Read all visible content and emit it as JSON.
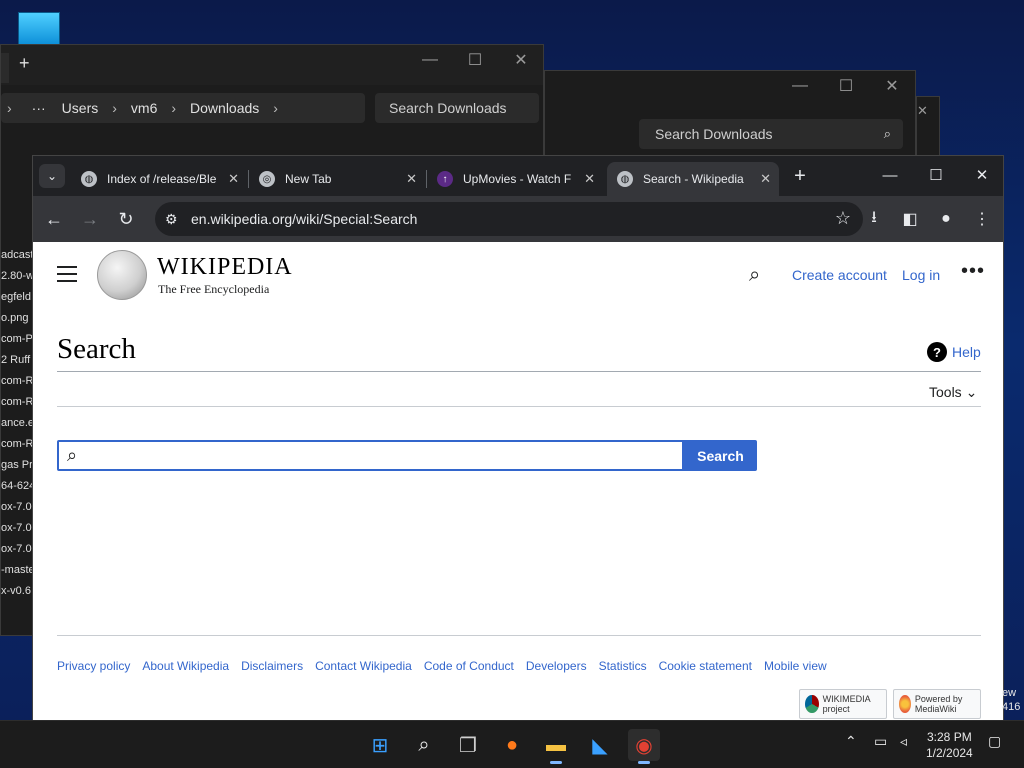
{
  "explorer_front": {
    "breadcrumbs": [
      "Users",
      "vm6",
      "Downloads"
    ],
    "search_placeholder": "Search Downloads",
    "new_tab": "+",
    "partial_files": [
      "adcast",
      "2.80-w",
      "egfeld",
      "o.png",
      "com-P",
      "2 Ruff",
      "com-R",
      "com-R",
      "ance.e",
      "com-R",
      "gas Pro",
      "64-624",
      "ox-7.0.",
      "ox-7.0.",
      "ox-7.0.",
      "-maste",
      "x-v0.6"
    ]
  },
  "explorer_back": {
    "search_placeholder": "Search Downloads"
  },
  "browser": {
    "tabs": [
      {
        "title": "Index of /release/Ble",
        "favicon": "globe-icon",
        "active": false
      },
      {
        "title": "New Tab",
        "favicon": "chrome-icon",
        "active": false
      },
      {
        "title": "UpMovies - Watch F",
        "favicon": "upmovies-icon",
        "active": false
      },
      {
        "title": "Search - Wikipedia",
        "favicon": "globe-icon",
        "active": true
      }
    ],
    "url": "en.wikipedia.org/wiki/Special:Search"
  },
  "wiki": {
    "wordmark": "WIKIPEDIA",
    "tagline": "The Free Encyclopedia",
    "create_account": "Create account",
    "log_in": "Log in",
    "page_title": "Search",
    "help": "Help",
    "tools": "Tools",
    "search_value": "",
    "search_button": "Search",
    "footer_links": [
      "Privacy policy",
      "About Wikipedia",
      "Disclaimers",
      "Contact Wikipedia",
      "Code of Conduct",
      "Developers",
      "Statistics",
      "Cookie statement",
      "Mobile view"
    ],
    "badge_wikimedia": "WIKIMEDIA project",
    "badge_mediawiki": "Powered by MediaWiki"
  },
  "taskbar": {
    "time": "3:28 PM",
    "date": "1/2/2024",
    "edge_text_1": "ew",
    "edge_text_2": "416"
  },
  "colors": {
    "link_blue": "#3366cc",
    "chrome_dark": "#202124",
    "chrome_toolbar": "#35363a"
  }
}
